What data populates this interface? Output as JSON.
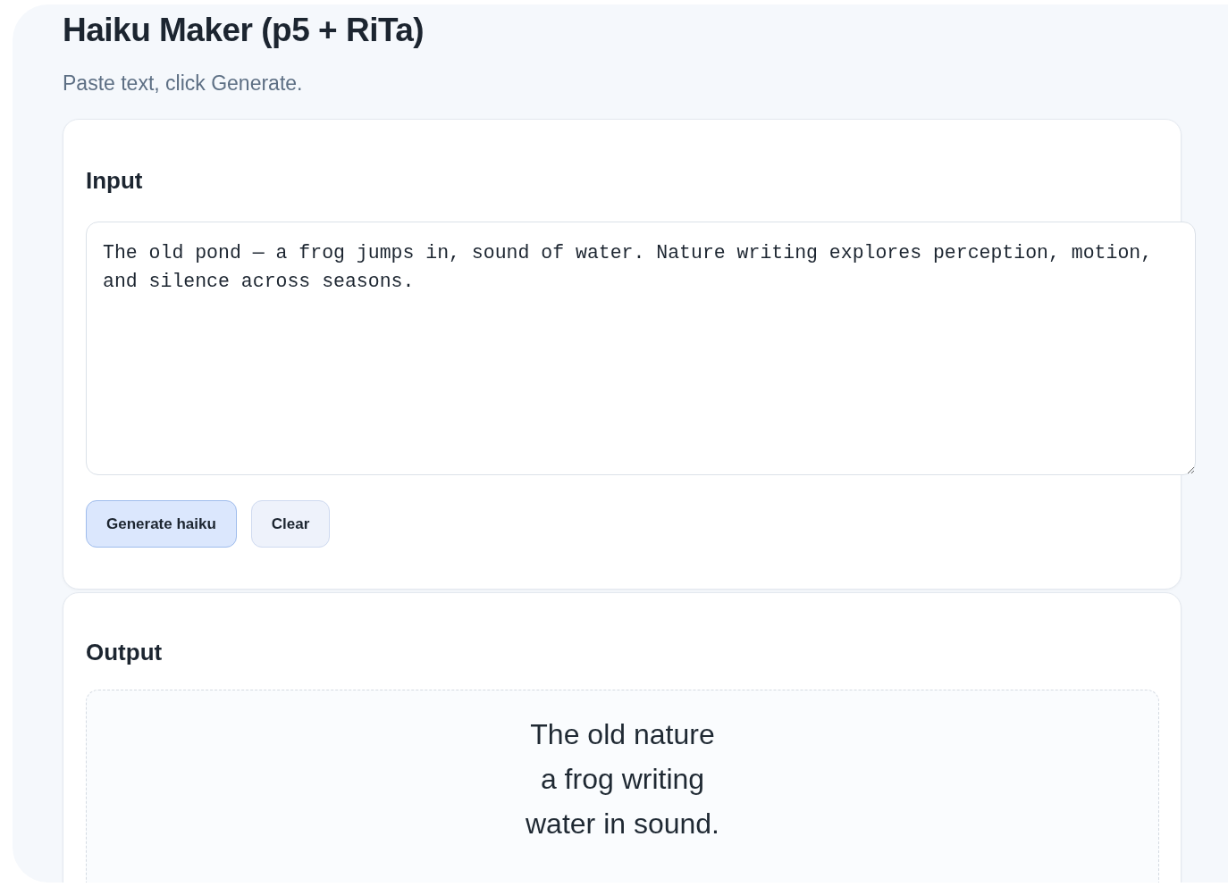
{
  "title": "Haiku Maker (p5 + RiTa)",
  "subtitle": "Paste text, click Generate.",
  "input": {
    "heading": "Input",
    "value": "The old pond — a frog jumps in, sound of water. Nature writing explores perception, motion, and silence across seasons."
  },
  "buttons": [
    {
      "label": "Generate haiku",
      "kind": "primary"
    },
    {
      "label": "Clear",
      "kind": "secondary"
    }
  ],
  "output": {
    "heading": "Output",
    "lines": [
      "The old nature",
      "a frog writing",
      "water in sound."
    ]
  }
}
